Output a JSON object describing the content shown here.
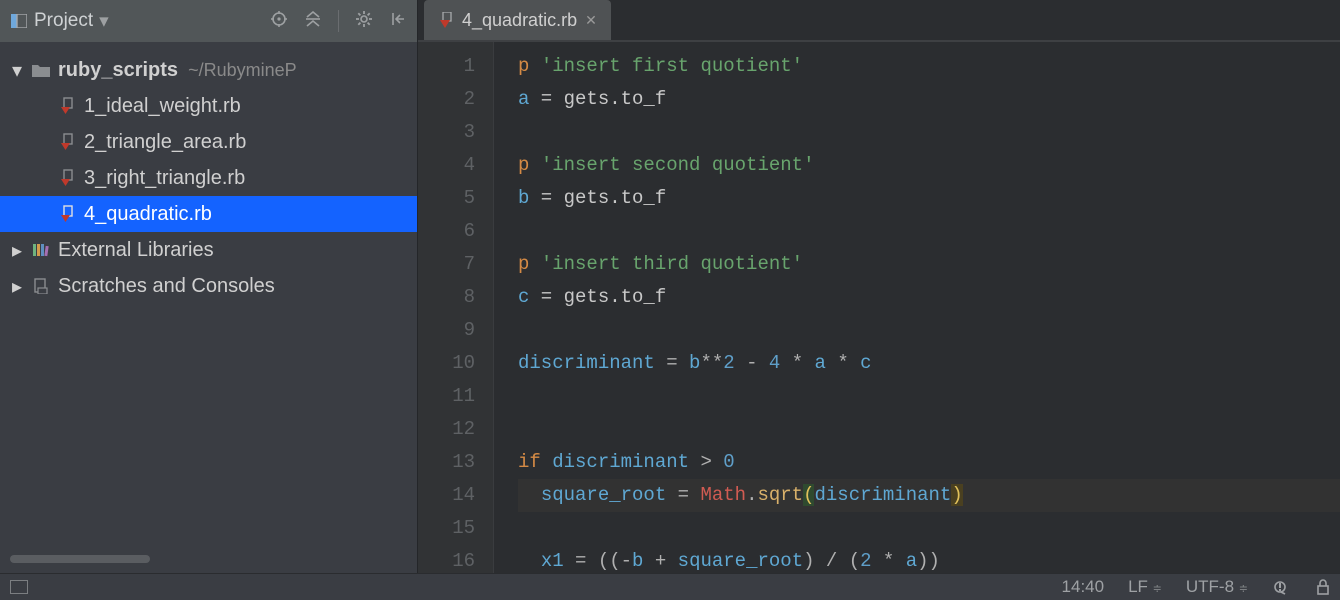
{
  "project_panel": {
    "title": "Project",
    "root": {
      "name": "ruby_scripts",
      "path_suffix": "~/RubymineP"
    },
    "files": [
      {
        "name": "1_ideal_weight.rb"
      },
      {
        "name": "2_triangle_area.rb"
      },
      {
        "name": "3_right_triangle.rb"
      },
      {
        "name": "4_quadratic.rb"
      }
    ],
    "external_libs": "External Libraries",
    "scratches": "Scratches and Consoles"
  },
  "editor": {
    "tab_name": "4_quadratic.rb",
    "line_numbers": [
      "1",
      "2",
      "3",
      "4",
      "5",
      "6",
      "7",
      "8",
      "9",
      "10",
      "11",
      "12",
      "13",
      "14",
      "15",
      "16"
    ],
    "lines": {
      "l1": {
        "p": "p ",
        "q1": "'",
        "s": "insert first quotient",
        "q2": "'"
      },
      "l2": {
        "v": "a",
        "rest": " = gets.to_f"
      },
      "l3": "",
      "l4": {
        "p": "p ",
        "q1": "'",
        "s": "insert second quotient",
        "q2": "'"
      },
      "l5": {
        "v": "b",
        "rest": " = gets.to_f"
      },
      "l6": "",
      "l7": {
        "p": "p ",
        "q1": "'",
        "s": "insert third quotient",
        "q2": "'"
      },
      "l8": {
        "v": "c",
        "rest": " = gets.to_f"
      },
      "l9": "",
      "l10": {
        "v": "discriminant",
        "mid": " = ",
        "b": "b",
        "e": "**",
        "two": "2",
        "minus": " - ",
        "four": "4",
        "star1": " * ",
        "a": "a",
        "star2": " * ",
        "cc": "c"
      },
      "l11": "",
      "l12": "",
      "l13": {
        "kw": "if ",
        "v": "discriminant",
        "gt": " > ",
        "zero": "0"
      },
      "l14": {
        "indent": "  ",
        "sr": "square_root",
        "eq": " = ",
        "math": "Math",
        "dot": ".",
        "sqrt": "sqrt",
        "lp": "(",
        "d": "discriminant",
        "rp": ")"
      },
      "l15": "",
      "l16": {
        "indent": "  ",
        "x1": "x1",
        "eq": " = ((-",
        "b": "b",
        "plus": " + ",
        "sr": "square_root",
        "mid": ") / (",
        "two": "2",
        "star": " * ",
        "a": "a",
        "end": "))"
      }
    }
  },
  "status": {
    "pos": "14:40",
    "le": "LF",
    "enc": "UTF-8"
  }
}
